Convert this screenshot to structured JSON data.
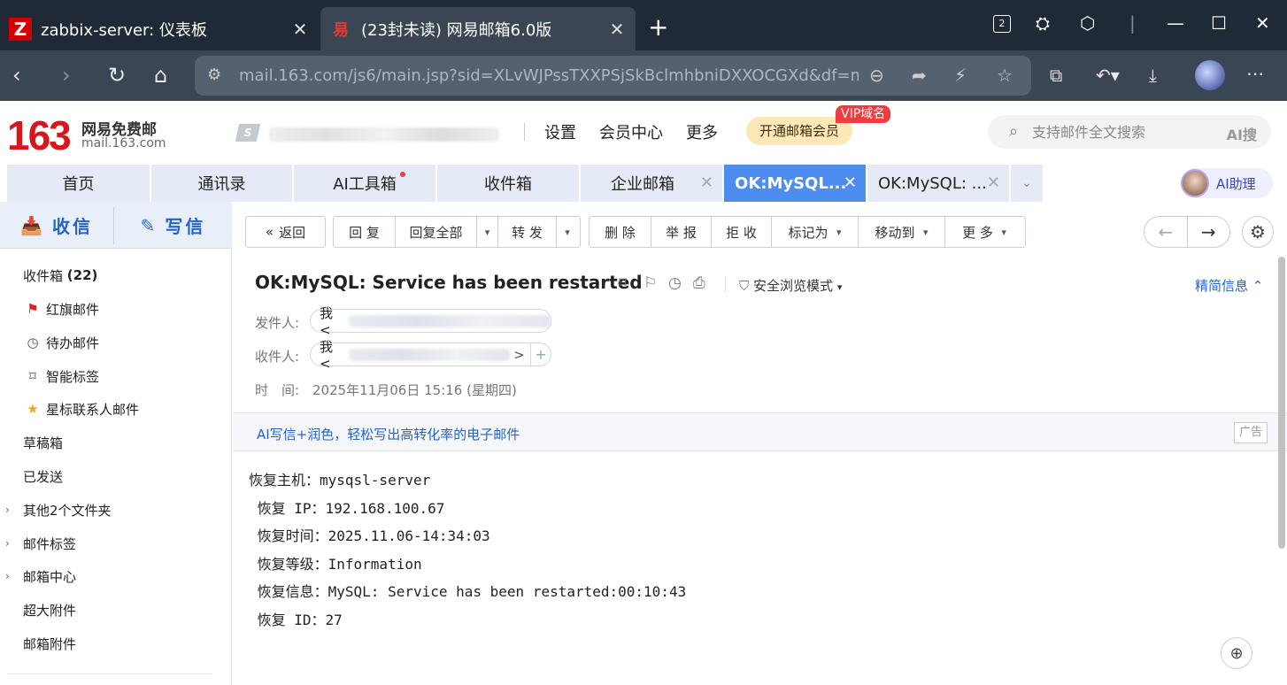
{
  "browser": {
    "tabs": [
      {
        "favicon": "Z",
        "title": "zabbix-server: 仪表板"
      },
      {
        "favicon": "易",
        "title": "(23封未读) 网易邮箱6.0版"
      }
    ],
    "tab_count": "2",
    "url": "mail.163.com/js6/main.jsp?sid=XLvWJPssTXXPSjSkBclmhbniDXXOCGXd&df=m..."
  },
  "header": {
    "logo_number": "163",
    "logo_name": "网易免费邮",
    "logo_domain": "mail.163.com",
    "links": [
      "设置",
      "会员中心",
      "更多"
    ],
    "vip_button": "开通邮箱会员",
    "vip_badge": "VIP域名",
    "search_placeholder": "支持邮件全文搜索",
    "search_ai": "AI搜"
  },
  "mail_tabs": [
    {
      "label": "首页"
    },
    {
      "label": "通讯录"
    },
    {
      "label": "AI工具箱"
    },
    {
      "label": "收件箱"
    },
    {
      "label": "企业邮箱"
    },
    {
      "label": "OK:MySQL..."
    },
    {
      "label": "OK:MySQL: ..."
    }
  ],
  "ai_helper": "AI助理",
  "sidebar": {
    "receive": "收信",
    "compose": "写信",
    "folders": [
      {
        "label": "收件箱",
        "count": "(22)"
      },
      {
        "label": "红旗邮件"
      },
      {
        "label": "待办邮件"
      },
      {
        "label": "智能标签"
      },
      {
        "label": "星标联系人邮件"
      },
      {
        "label": "草稿箱"
      },
      {
        "label": "已发送"
      },
      {
        "label": "其他2个文件夹"
      },
      {
        "label": "邮件标签"
      },
      {
        "label": "邮箱中心"
      },
      {
        "label": "超大附件"
      },
      {
        "label": "邮箱附件"
      }
    ]
  },
  "toolbar": {
    "back": "返回",
    "reply": "回 复",
    "reply_all": "回复全部",
    "forward": "转 发",
    "delete": "删 除",
    "report": "举 报",
    "reject": "拒 收",
    "mark_as": "标记为",
    "move_to": "移动到",
    "more": "更 多"
  },
  "mail": {
    "subject": "OK:MySQL: Service has been restarted",
    "safe_mode": "安全浏览模式",
    "simple_info": "精简信息",
    "from_label": "发件人:",
    "to_label": "收件人:",
    "time_label": "时　间:",
    "from_name": "我<",
    "to_name": "我<",
    "to_tail": ">",
    "time": "2025年11月06日 15:16 (星期四)",
    "ad_text": "AI写信+润色，轻松写出高转化率的电子邮件",
    "ad_tag": "广告",
    "body": [
      "恢复主机：mysqsl-server",
      " 恢复 IP：192.168.100.67",
      " 恢复时间：2025.11.06-14:34:03",
      " 恢复等级：Information",
      " 恢复信息：MySQL: Service has been restarted:00:10:43",
      " 恢复 ID：27"
    ]
  }
}
